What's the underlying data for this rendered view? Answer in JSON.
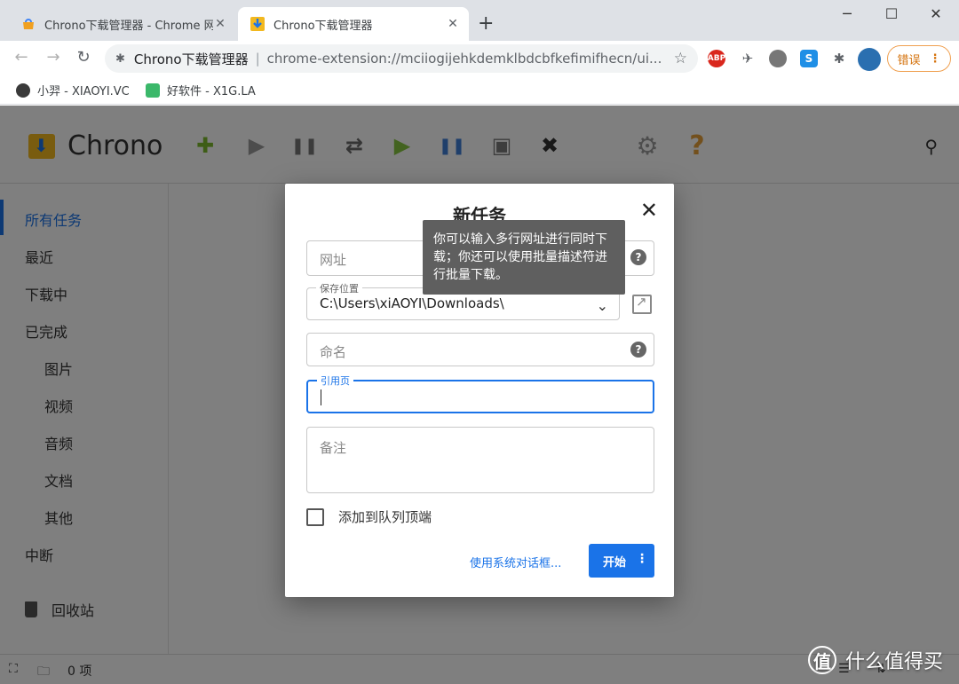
{
  "browser": {
    "tabs": [
      {
        "title": "Chrono下载管理器 - Chrome 网",
        "active": false
      },
      {
        "title": "Chrono下载管理器",
        "active": true
      }
    ],
    "new_tab": "+",
    "window_controls": {
      "minimize": "─",
      "maximize": "☐",
      "close": "✕"
    },
    "nav": {
      "back": "←",
      "forward": "→",
      "reload": "↻"
    },
    "omnibox": {
      "title": "Chrono下载管理器",
      "separator": "|",
      "url": "chrome-extension://mciiogijehkdemklbdcbfkefimifhecn/ui..."
    },
    "extensions": [
      {
        "name": "abp-icon",
        "label": "ABP",
        "color": "#d9271d"
      },
      {
        "name": "bird-icon",
        "label": "",
        "color": "#5f6368"
      },
      {
        "name": "owl-icon",
        "label": "",
        "color": "#777777"
      },
      {
        "name": "s-icon",
        "label": "S",
        "color": "#1f8fe6"
      },
      {
        "name": "puzzle-icon",
        "label": "",
        "color": "#5f6368"
      }
    ],
    "error_button": "错误",
    "bookmarks": [
      {
        "label": "小羿 - XIAOYI.VC",
        "color": "#3a3a3a"
      },
      {
        "label": "好软件 - X1G.LA",
        "color": "#3bb86a"
      }
    ]
  },
  "app": {
    "name": "Chrono",
    "toolbar": [
      {
        "name": "add-icon",
        "glyph": "✚",
        "color": "#7dbb2c"
      },
      {
        "name": "play-icon",
        "glyph": "▶",
        "color": "#9a9a9a"
      },
      {
        "name": "pause-icon",
        "glyph": "❚❚",
        "color": "#777777"
      },
      {
        "name": "redo-icon",
        "glyph": "⇄",
        "color": "#6a6a6a"
      },
      {
        "name": "start-all-icon",
        "glyph": "▶",
        "color": "#86c640"
      },
      {
        "name": "pause-all-icon",
        "glyph": "❚❚",
        "color": "#3e7fd6"
      },
      {
        "name": "clear-icon",
        "glyph": "▣",
        "color": "#7a7a7a"
      },
      {
        "name": "delete-icon",
        "glyph": "✖",
        "color": "#333333"
      },
      {
        "name": "settings-icon",
        "glyph": "⚙",
        "color": "#9a9a9a"
      },
      {
        "name": "help-icon",
        "glyph": "?",
        "color": "#e6a03a"
      }
    ],
    "sidebar": {
      "items": [
        {
          "label": "所有任务",
          "sub": false,
          "active": true
        },
        {
          "label": "最近",
          "sub": false,
          "active": false
        },
        {
          "label": "下载中",
          "sub": false,
          "active": false
        },
        {
          "label": "已完成",
          "sub": false,
          "active": false
        },
        {
          "label": "图片",
          "sub": true,
          "active": false
        },
        {
          "label": "视频",
          "sub": true,
          "active": false
        },
        {
          "label": "音频",
          "sub": true,
          "active": false
        },
        {
          "label": "文档",
          "sub": true,
          "active": false
        },
        {
          "label": "其他",
          "sub": true,
          "active": false
        },
        {
          "label": "中断",
          "sub": false,
          "active": false
        }
      ],
      "trash": "回收站"
    },
    "status": {
      "count": "0 项"
    }
  },
  "dialog": {
    "title": "新任务",
    "url_placeholder": "网址",
    "url_tooltip": "你可以输入多行网址进行同时下载；你还可以使用批量描述符进行批量下载。",
    "save_location_label": "保存位置",
    "save_location_value": "C:\\Users\\xiAOYI\\Downloads\\",
    "name_placeholder": "命名",
    "referrer_label": "引用页",
    "note_placeholder": "备注",
    "queue_top_label": "添加到队列顶端",
    "queue_top_checked": false,
    "system_dialog_link": "使用系统对话框...",
    "start_button": "开始"
  },
  "watermark": {
    "logo": "值",
    "text": "什么值得买"
  }
}
